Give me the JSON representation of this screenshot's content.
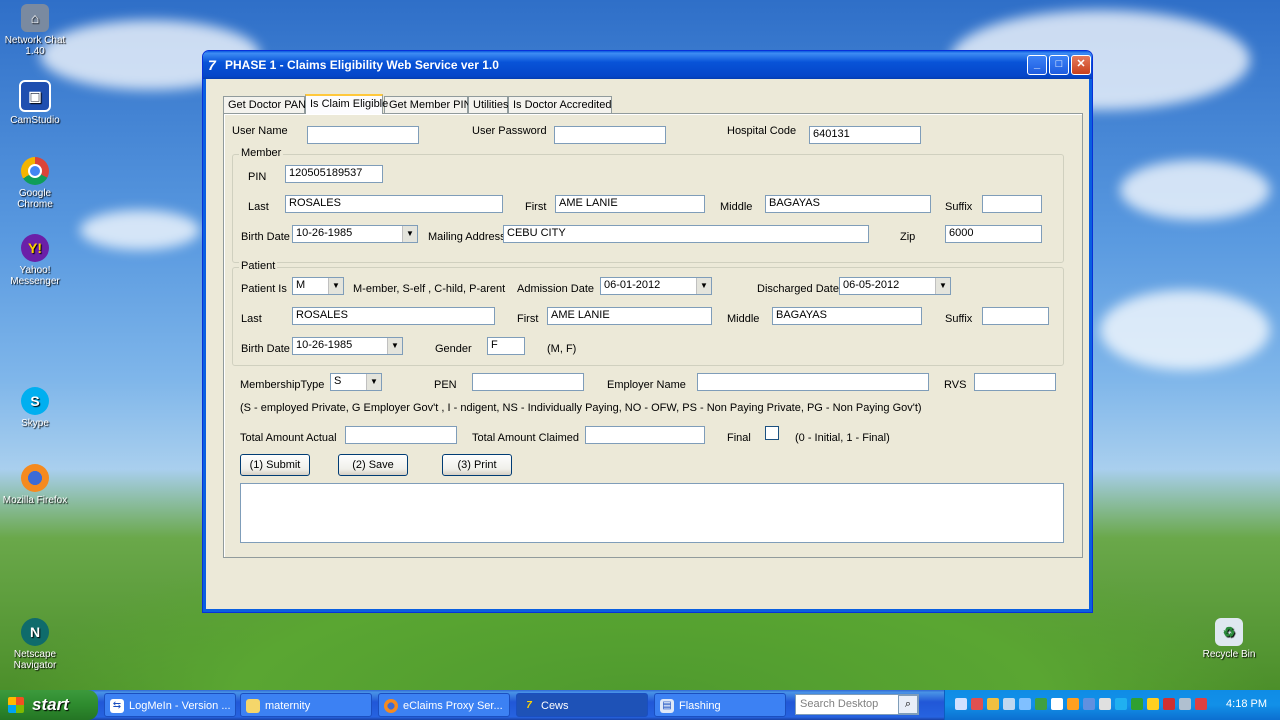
{
  "desktop": {
    "icons": [
      {
        "label": "Network Chat 1.40",
        "icon": "network-chat-icon"
      },
      {
        "label": "CamStudio",
        "icon": "camstudio-icon"
      },
      {
        "label": "Google Chrome",
        "icon": "chrome-icon"
      },
      {
        "label": "Yahoo! Messenger",
        "icon": "yahoo-messenger-icon"
      },
      {
        "label": "Skype",
        "icon": "skype-icon"
      },
      {
        "label": "Mozilla Firefox",
        "icon": "firefox-icon"
      },
      {
        "label": "Netscape Navigator",
        "icon": "netscape-icon"
      },
      {
        "label": "Recycle Bin",
        "icon": "recycle-bin-icon"
      }
    ]
  },
  "window": {
    "title": "PHASE 1 - Claims Eligibility Web Service ver 1.0",
    "controls": {
      "minimize": "_",
      "maximize": "□",
      "close": "✕"
    }
  },
  "tabs": [
    "Get Doctor PAN",
    "Is Claim Eligible",
    "Get Member PIN",
    "Utilities",
    "Is Doctor Accredited"
  ],
  "active_tab": "Is Claim Eligible",
  "login": {
    "user_name_label": "User Name",
    "user_name": "",
    "password_label": "User Password",
    "password": "",
    "hospital_code_label": "Hospital Code",
    "hospital_code": "640131"
  },
  "member": {
    "group_label": "Member",
    "pin_label": "PIN",
    "pin": "120505189537",
    "last_label": "Last",
    "last": "ROSALES",
    "first_label": "First",
    "first": "AME LANIE",
    "middle_label": "Middle",
    "middle": "BAGAYAS",
    "suffix_label": "Suffix",
    "suffix": "",
    "birth_date_label": "Birth Date",
    "birth_date": "10-26-1985",
    "mailing_address_label": "Mailing Address",
    "mailing_address": "CEBU CITY",
    "zip_label": "Zip",
    "zip": "6000"
  },
  "patient": {
    "group_label": "Patient",
    "patient_is_label": "Patient Is",
    "patient_is": "M",
    "patient_is_hint": "M-ember, S-elf , C-hild, P-arent",
    "admission_date_label": "Admission Date",
    "admission_date": "06-01-2012",
    "discharged_date_label": "Discharged Date",
    "discharged_date": "06-05-2012",
    "last_label": "Last",
    "last": "ROSALES",
    "first_label": "First",
    "first": "AME LANIE",
    "middle_label": "Middle",
    "middle": "BAGAYAS",
    "suffix_label": "Suffix",
    "suffix": "",
    "birth_date_label": "Birth Date",
    "birth_date": "10-26-1985",
    "gender_label": "Gender",
    "gender": "F",
    "gender_hint": "(M, F)"
  },
  "claim": {
    "membership_type_label": "MembershipType",
    "membership_type": "S",
    "pen_label": "PEN",
    "pen": "",
    "employer_name_label": "Employer Name",
    "employer_name": "",
    "rvs_label": "RVS",
    "rvs": "",
    "membership_hint": "(S - employed Private, G Employer Gov't , I - ndigent, NS - Individually Paying, NO - OFW, PS - Non Paying Private, PG - Non Paying Gov't)",
    "total_actual_label": "Total Amount Actual",
    "total_actual": "",
    "total_claimed_label": "Total Amount Claimed",
    "total_claimed": "",
    "final_label": "Final",
    "final_hint": "(0 - Initial, 1 - Final)"
  },
  "buttons": {
    "submit": "(1) Submit",
    "save": "(2) Save",
    "print": "(3) Print"
  },
  "taskbar": {
    "start_label": "start",
    "tasks": [
      {
        "label": "LogMeIn - Version ...",
        "icon": "logmein-icon"
      },
      {
        "label": "maternity",
        "icon": "folder-icon"
      },
      {
        "label": "eClaims Proxy Ser...",
        "icon": "firefox-icon"
      },
      {
        "label": "Cews",
        "icon": "app-icon"
      },
      {
        "label": "Flashing",
        "icon": "flashing-icon"
      }
    ],
    "search_placeholder": "Search Desktop",
    "clock": "4:18 PM"
  }
}
